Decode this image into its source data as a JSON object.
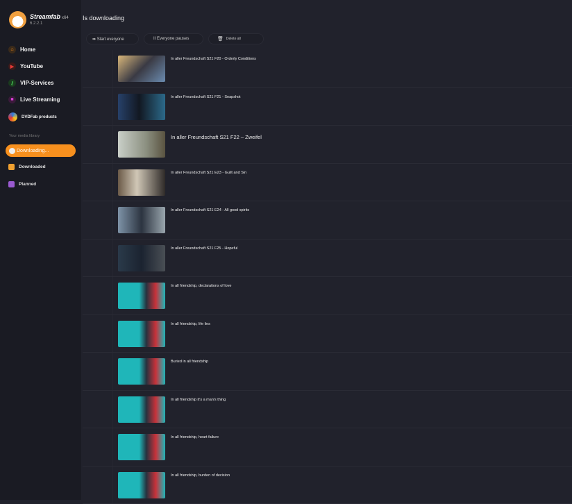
{
  "app": {
    "name": "Streamfab",
    "arch": "x64",
    "version": "6.2.2.1"
  },
  "sidebar": {
    "items": [
      {
        "label": "Home",
        "icon": "home-icon",
        "color": "#f7901e"
      },
      {
        "label": "YouTube",
        "icon": "youtube-icon",
        "color": "#e53935"
      },
      {
        "label": "VIP-Services",
        "icon": "key-icon",
        "color": "#3fae4a"
      },
      {
        "label": "Live Streaming",
        "icon": "camera-icon",
        "color": "#d63fd6"
      },
      {
        "label": "DVDFab products",
        "icon": "dvdfab-icon",
        "color": "#2f7de1"
      }
    ],
    "library_label": "Your media library",
    "library": [
      {
        "label": "Downloading...",
        "active": true
      },
      {
        "label": "Downloaded",
        "color": "#f0a030"
      },
      {
        "label": "Planned",
        "color": "#9a5ad0"
      }
    ]
  },
  "main": {
    "title": "Is downloading",
    "toolbar": {
      "start": "➡ Start everyone",
      "pause": "II Everyone pauses",
      "delete": "Delete all"
    },
    "items": [
      "In aller Freundschaft S21 F20 - Orderly Conditions",
      "In aller Freundschaft S21 F21 - Snapshot",
      "In aller Freundschaft S21 F22 – Zweifel",
      "In aller Freundschaft S21 E23 - Guilt and Sin",
      "In aller Freundschaft S21 E24 - All good spirits",
      "In aller Freundschaft S21 F25 - Hopeful",
      "In all friendship, declarations of love",
      "In all friendship, life lies",
      "Buried in all friendship",
      "In all friendship it's a man's thing",
      "In all friendship, heart failure",
      "In all friendship, burden of decision"
    ]
  }
}
